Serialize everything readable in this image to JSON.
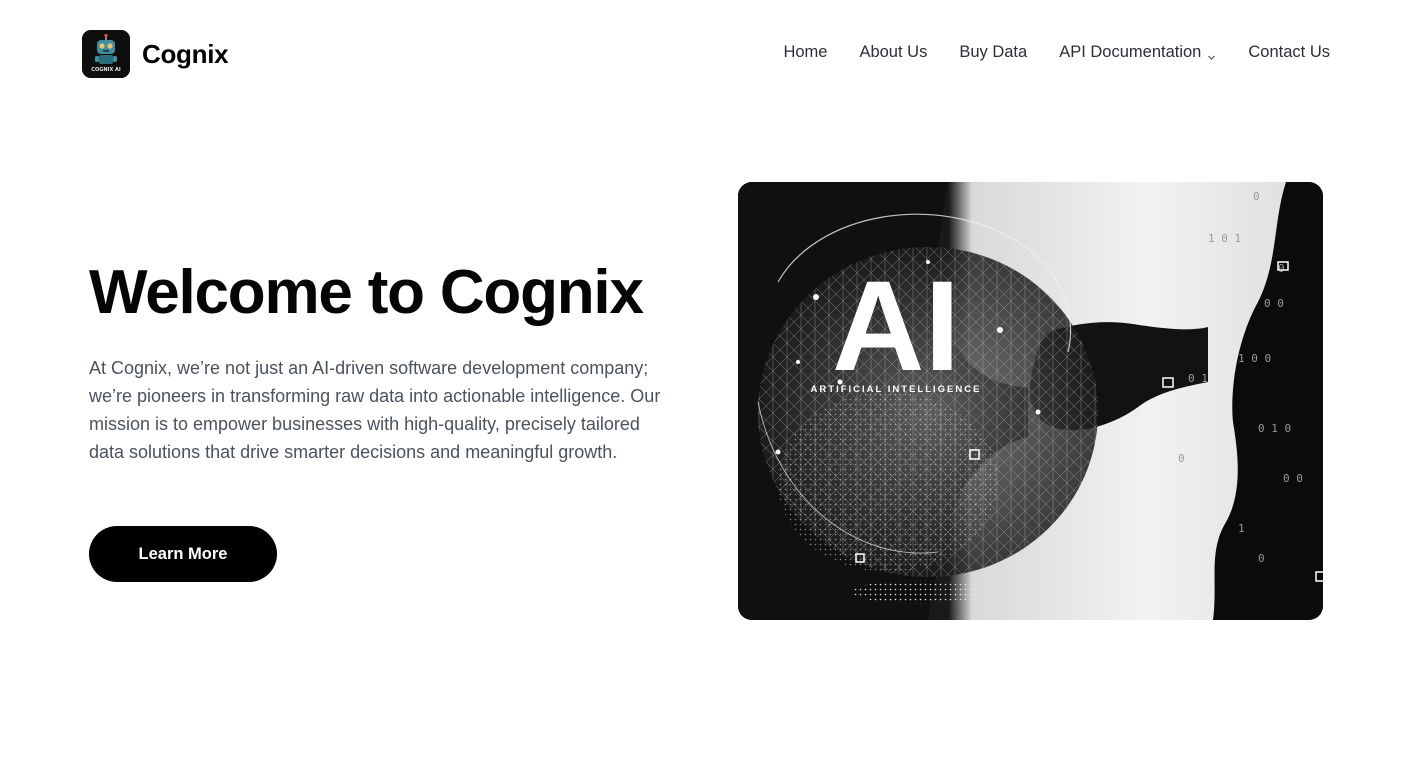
{
  "brand": {
    "name": "Cognix",
    "logo_text": "COGNIX AI"
  },
  "nav": {
    "items": [
      {
        "label": "Home"
      },
      {
        "label": "About Us"
      },
      {
        "label": "Buy Data"
      },
      {
        "label": "API Documentation",
        "icon": "chevron-down-icon"
      },
      {
        "label": "Contact Us"
      }
    ]
  },
  "hero": {
    "title": "Welcome to Cognix",
    "description": "At Cognix, we’re not just an AI-driven software development company; we’re pioneers in transforming raw data into actionable intelligence. Our mission is to empower businesses with high-quality, precisely tailored data solutions that drive smarter decisions and meaningful growth.",
    "cta_label": "Learn More",
    "image": {
      "headline": "AI",
      "subtitle": "ARTIFICIAL INTELLIGENCE"
    }
  },
  "colors": {
    "text_primary": "#050505",
    "text_body": "#4b5260",
    "nav_text": "#2b2f36",
    "cta_bg": "#000000",
    "cta_text": "#ffffff"
  }
}
